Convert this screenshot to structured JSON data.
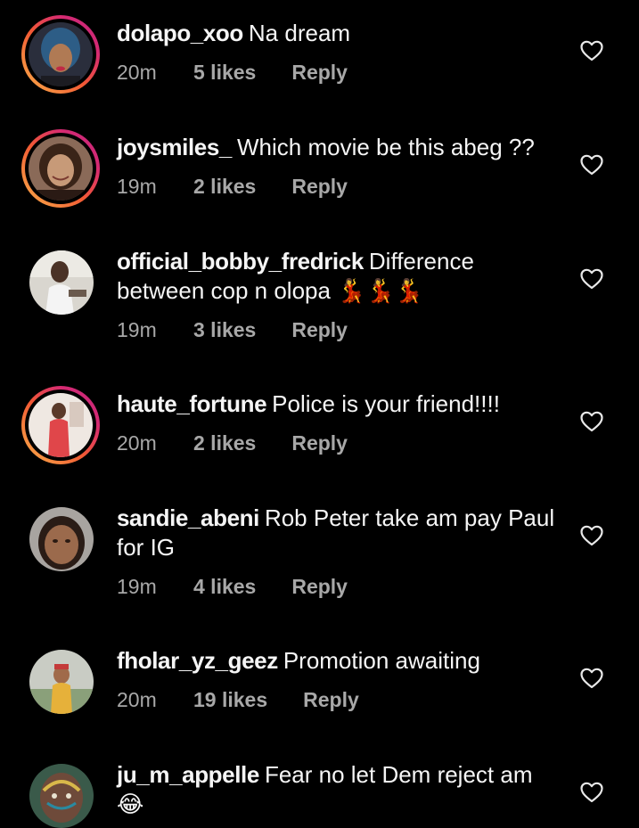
{
  "comments": [
    {
      "username": "dolapo_xoo",
      "text": "Na dream",
      "time": "20m",
      "likes": "5 likes",
      "reply": "Reply",
      "avatar": "avatar-woman-blue-hair"
    },
    {
      "username": "joysmiles_",
      "text": "Which movie be this abeg ??",
      "time": "19m",
      "likes": "2 likes",
      "reply": "Reply",
      "avatar": "avatar-woman-smiling"
    },
    {
      "username": "official_bobby_fredrick",
      "text": "Difference between cop n olopa 💃💃💃",
      "time": "19m",
      "likes": "3 likes",
      "reply": "Reply",
      "avatar": "avatar-man-seated"
    },
    {
      "username": "haute_fortune",
      "text": "Police is your friend!!!!",
      "time": "20m",
      "likes": "2 likes",
      "reply": "Reply",
      "avatar": "avatar-woman-red-dress"
    },
    {
      "username": "sandie_abeni",
      "text": "Rob Peter take am pay Paul for IG",
      "time": "19m",
      "likes": "4 likes",
      "reply": "Reply",
      "avatar": "avatar-girl-closeup"
    },
    {
      "username": "fholar_yz_geez",
      "text": "Promotion awaiting",
      "time": "20m",
      "likes": "19 likes",
      "reply": "Reply",
      "avatar": "avatar-person-outdoors"
    },
    {
      "username": "ju_m_appelle",
      "text": "Fear no let Dem reject am 😂",
      "time": "",
      "likes": "",
      "reply": "",
      "avatar": "avatar-painted-face"
    }
  ],
  "icons": {
    "like": "heart-outline-icon"
  },
  "colors": {
    "background": "#000000",
    "primary_text": "#f5f5f5",
    "secondary_text": "#a8a8a8",
    "story_ring_start": "#f9b24a",
    "story_ring_end": "#c1267f"
  }
}
